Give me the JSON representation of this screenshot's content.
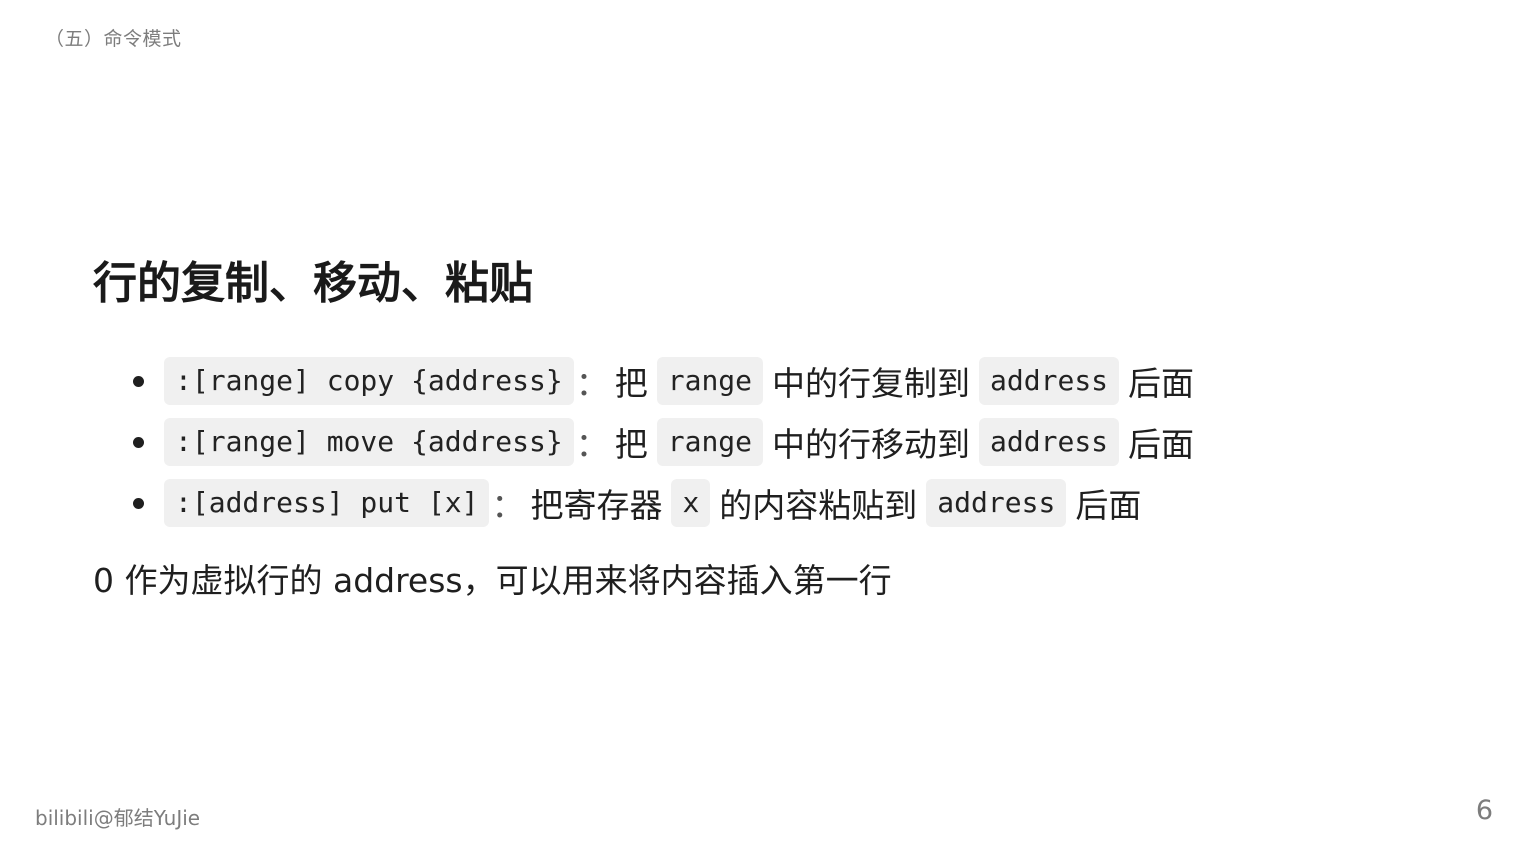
{
  "header": {
    "section_label": "（五）命令模式"
  },
  "main": {
    "title": "行的复制、移动、粘贴",
    "items": [
      {
        "command": ":[range] copy {address}",
        "sep": "：",
        "t1": "把",
        "code1": "range",
        "t2": "中的行复制到",
        "code2": "address",
        "t3": "后面"
      },
      {
        "command": ":[range] move {address}",
        "sep": "：",
        "t1": "把",
        "code1": "range",
        "t2": "中的行移动到",
        "code2": "address",
        "t3": "后面"
      },
      {
        "command": ":[address] put [x]",
        "sep": "：",
        "t1": "把寄存器",
        "code1": "x",
        "t2": "的内容粘贴到",
        "code2": "address",
        "t3": "后面"
      }
    ],
    "note": "0 作为虚拟行的 address，可以用来将内容插入第一行"
  },
  "footer": {
    "author": "bilibili@郁结YuJie",
    "page_number": "6"
  }
}
